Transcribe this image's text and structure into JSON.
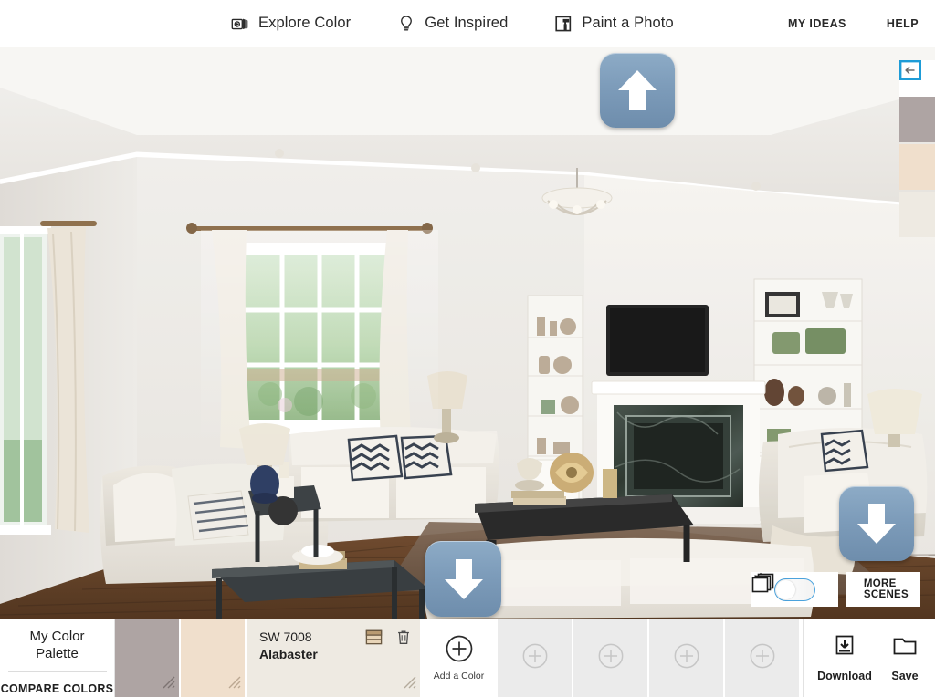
{
  "header": {
    "nav": [
      {
        "label": "Explore Color",
        "icon": "color-chips-icon"
      },
      {
        "label": "Get Inspired",
        "icon": "lightbulb-icon"
      },
      {
        "label": "Paint a Photo",
        "icon": "paint-roller-photo-icon"
      }
    ],
    "links": [
      {
        "label": "MY IDEAS"
      },
      {
        "label": "HELP"
      }
    ]
  },
  "scene": {
    "alt": "Living room interior with fireplace, sectional sofa, large window and built-in shelving",
    "arrows": [
      {
        "name": "paint-ceiling-arrow",
        "direction": "up"
      },
      {
        "name": "paint-floor-arrow",
        "direction": "down"
      },
      {
        "name": "paint-wall-right-arrow",
        "direction": "down"
      }
    ],
    "controls": {
      "light_icon": "sun-icon",
      "dark_icon": "moon-stars-icon",
      "toggle_state": "light",
      "more_scenes_label_line1": "MORE",
      "more_scenes_label_line2": "SCENES",
      "more_scenes_icon": "stacked-cards-icon"
    },
    "rail": {
      "collapse_icon": "collapse-panel-icon",
      "swatches": [
        {
          "name": "rail-swatch-1",
          "color": "#aea4a3"
        },
        {
          "name": "rail-swatch-2",
          "color": "#f0dfcc"
        },
        {
          "name": "rail-swatch-3",
          "color": "#eeeae2"
        }
      ]
    }
  },
  "palette": {
    "title_line1": "My Color",
    "title_line2": "Palette",
    "compare_label": "COMPARE COLORS",
    "chips": [
      {
        "name": "palette-chip-1",
        "color": "#aea4a3",
        "code": "",
        "color_name": ""
      },
      {
        "name": "palette-chip-2",
        "color": "#f0dfcc",
        "code": "",
        "color_name": ""
      },
      {
        "name": "palette-chip-3",
        "color": "#eeeae2",
        "code": "SW 7008",
        "color_name": "Alabaster"
      }
    ],
    "selected_chip_code": "SW 7008",
    "selected_chip_name": "Alabaster",
    "chip_actions": {
      "swatch_icon": "color-swatch-icon",
      "delete_icon": "trash-icon"
    },
    "add_color_label": "Add a Color",
    "add_color_icon": "plus-circle-icon",
    "empty_slots": 4,
    "actions": [
      {
        "label": "Download",
        "icon": "download-icon"
      },
      {
        "label": "Save",
        "icon": "folder-icon"
      }
    ]
  },
  "colors": {
    "accent_blue": "#4ba3dd",
    "arrow_button_blue": "#7d9cba",
    "chip_empty_gray": "#ebebeb"
  }
}
